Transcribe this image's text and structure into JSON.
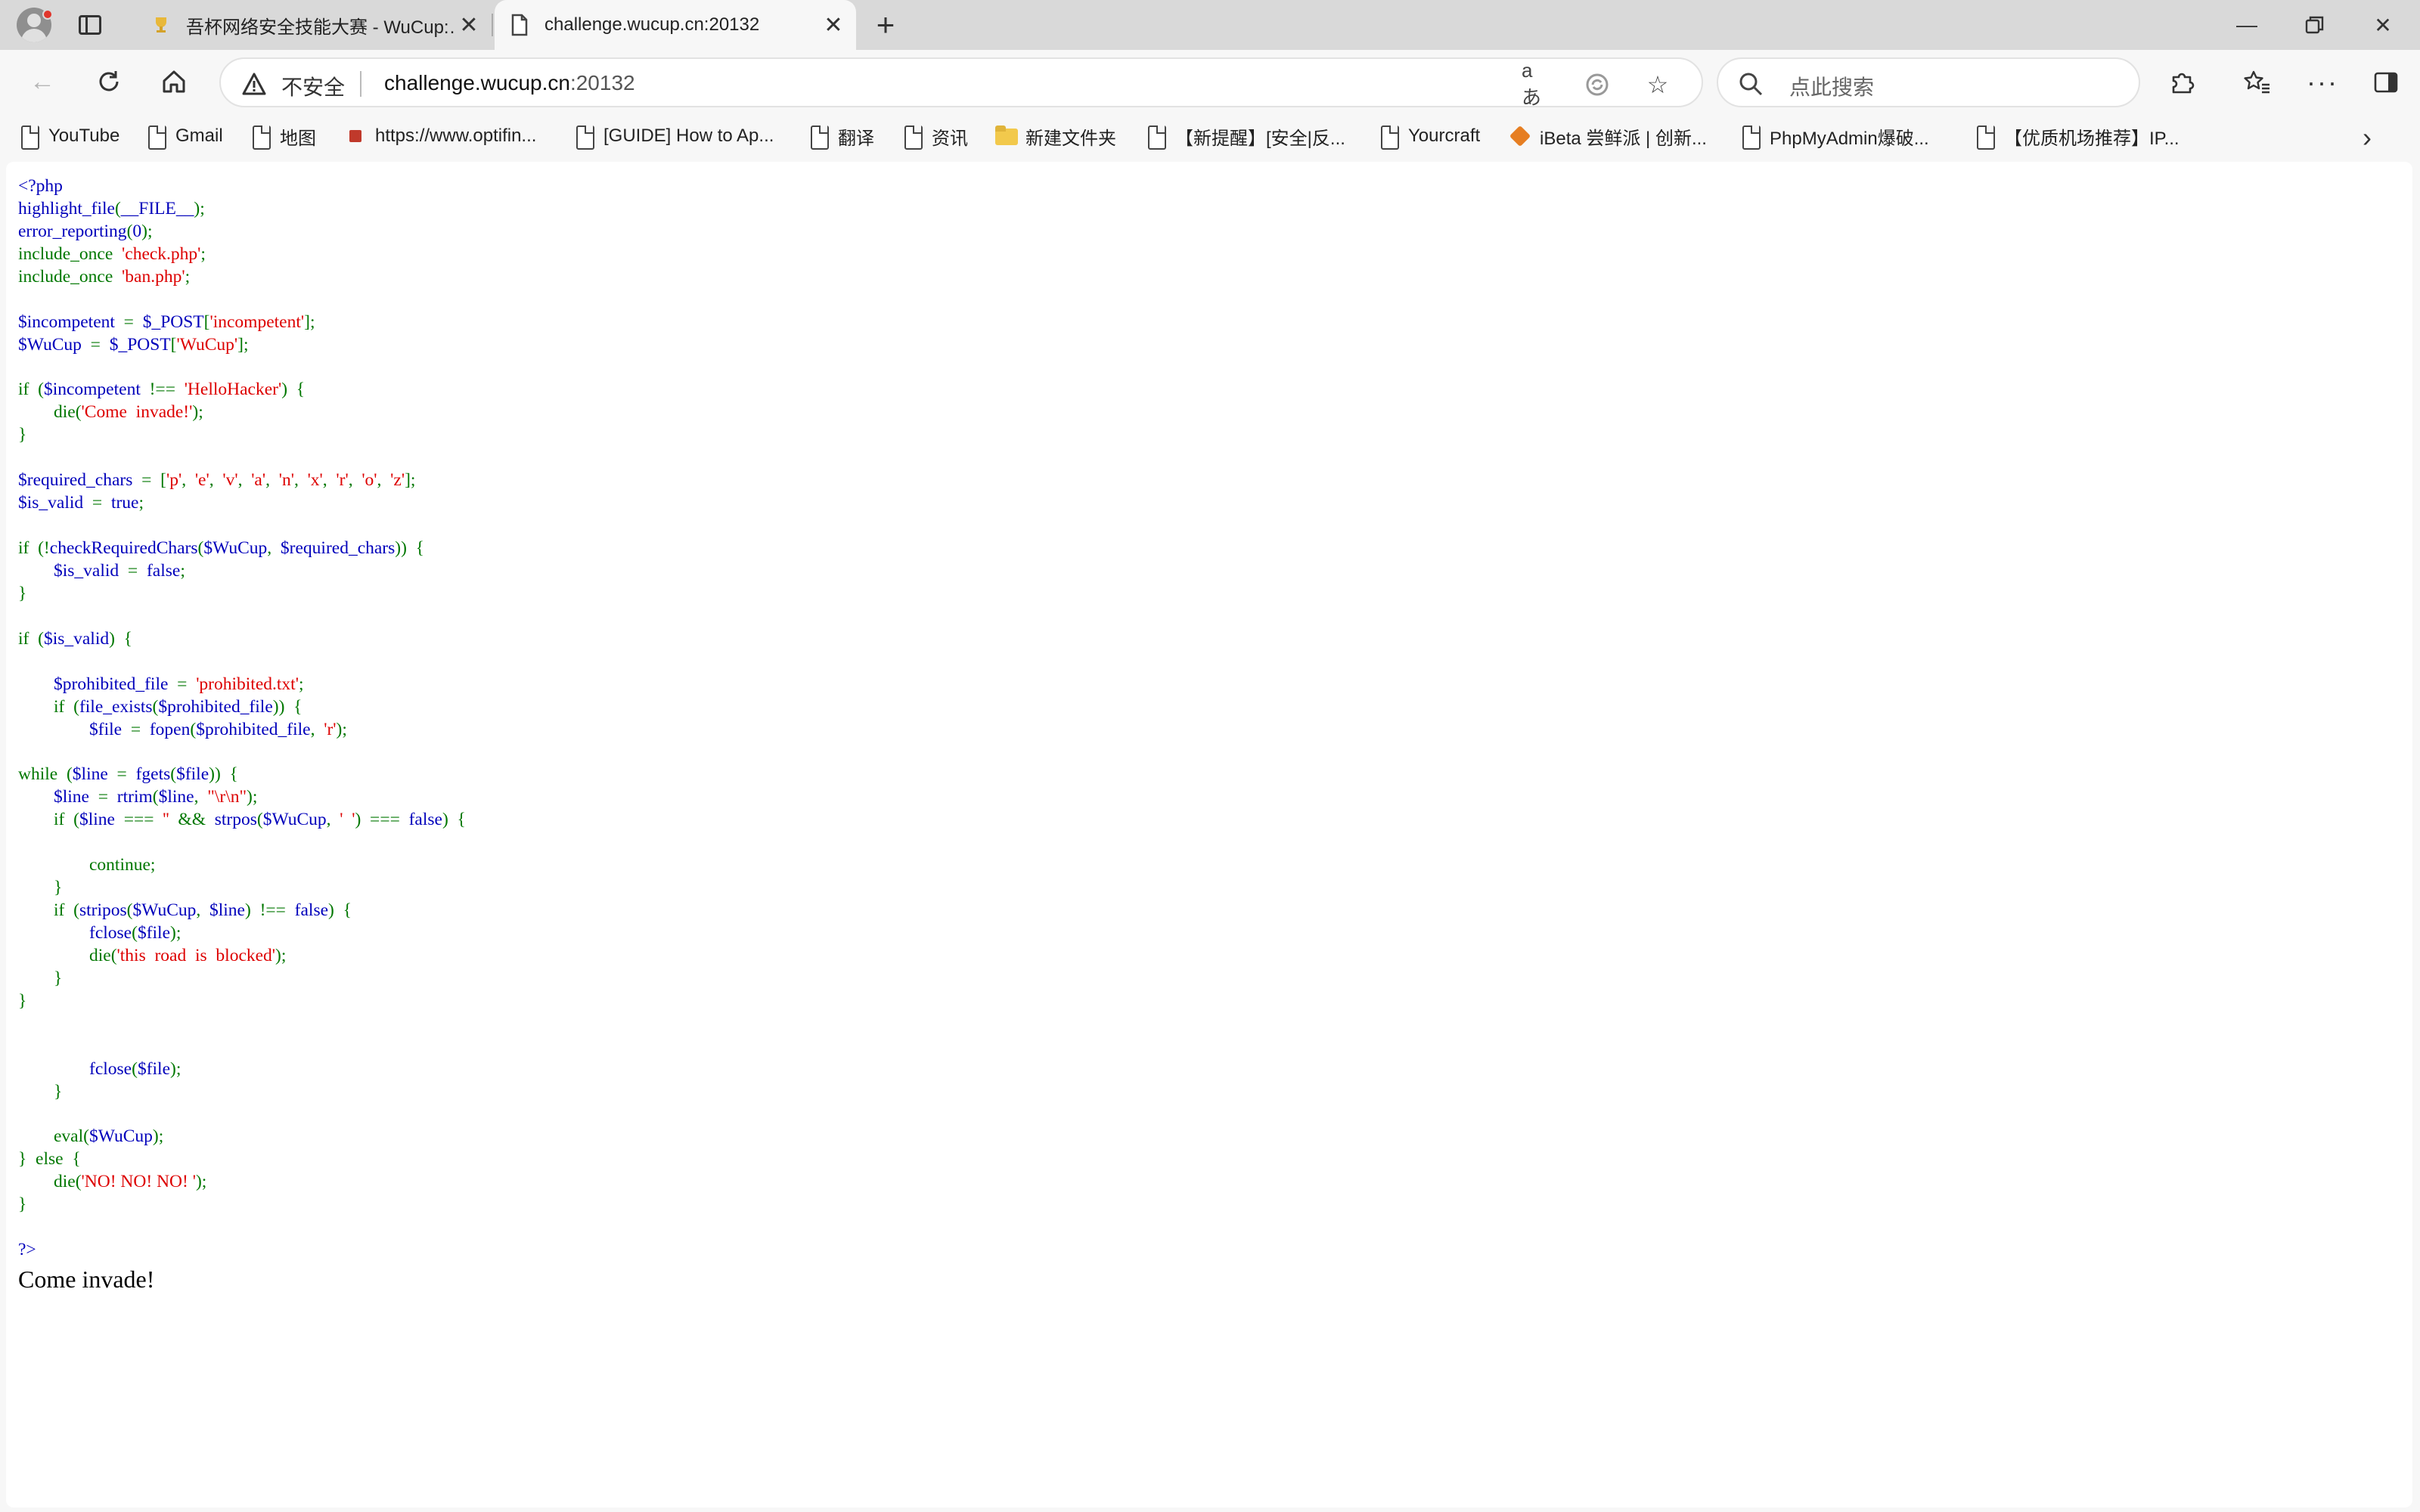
{
  "browser": {
    "tabs": [
      {
        "title": "吾杯网络安全技能大赛 - WuCup:…",
        "active": false
      },
      {
        "title": "challenge.wucup.cn:20132",
        "active": true
      }
    ],
    "address_bar": {
      "security_label": "不安全",
      "url_host": "challenge.wucup.cn",
      "url_port": ":20132"
    },
    "search": {
      "placeholder": "点此搜索"
    },
    "icons": {
      "back": "arrow-left-icon",
      "reload": "reload-icon",
      "home": "home-icon",
      "translate": "translate-icon",
      "star": "star-icon",
      "extensions": "puzzle-icon",
      "favorites": "favorites-icon",
      "more": "more-icon",
      "sidebar": "sidebar-icon"
    }
  },
  "bookmarks": [
    {
      "label": "YouTube",
      "icon": "doc"
    },
    {
      "label": "Gmail",
      "icon": "doc"
    },
    {
      "label": "地图",
      "icon": "doc"
    },
    {
      "label": "https://www.optifin...",
      "icon": "sq"
    },
    {
      "label": "[GUIDE] How to Ap...",
      "icon": "doc"
    },
    {
      "label": "翻译",
      "icon": "doc"
    },
    {
      "label": "资讯",
      "icon": "doc"
    },
    {
      "label": "新建文件夹",
      "icon": "folder"
    },
    {
      "label": "【新提醒】[安全|反...",
      "icon": "doc"
    },
    {
      "label": "Yourcraft",
      "icon": "doc"
    },
    {
      "label": "iBeta 尝鲜派 | 创新...",
      "icon": "ibeta"
    },
    {
      "label": "PhpMyAdmin爆破...",
      "icon": "doc"
    },
    {
      "label": "【优质机场推荐】IP...",
      "icon": "doc"
    }
  ],
  "code_lines": [
    [
      [
        "d",
        "&lt;?php"
      ]
    ],
    [
      [
        "d",
        "highlight_file"
      ],
      [
        "k",
        "("
      ],
      [
        "d",
        "__FILE__"
      ],
      [
        "k",
        ");"
      ]
    ],
    [
      [
        "d",
        "error_reporting"
      ],
      [
        "k",
        "("
      ],
      [
        "d",
        "0"
      ],
      [
        "k",
        ");"
      ]
    ],
    [
      [
        "k",
        "include_once&nbsp;&nbsp;"
      ],
      [
        "s",
        "'check.php'"
      ],
      [
        "k",
        ";"
      ]
    ],
    [
      [
        "k",
        "include_once&nbsp;&nbsp;"
      ],
      [
        "s",
        "'ban.php'"
      ],
      [
        "k",
        ";"
      ]
    ],
    [],
    [
      [
        "d",
        "$incompetent&nbsp;&nbsp;"
      ],
      [
        "k",
        "=&nbsp;&nbsp;"
      ],
      [
        "d",
        "$_POST"
      ],
      [
        "k",
        "["
      ],
      [
        "s",
        "'incompetent'"
      ],
      [
        "k",
        "];"
      ]
    ],
    [
      [
        "d",
        "$WuCup&nbsp;&nbsp;"
      ],
      [
        "k",
        "=&nbsp;&nbsp;"
      ],
      [
        "d",
        "$_POST"
      ],
      [
        "k",
        "["
      ],
      [
        "s",
        "'WuCup'"
      ],
      [
        "k",
        "];"
      ]
    ],
    [],
    [
      [
        "k",
        "if&nbsp;&nbsp;("
      ],
      [
        "d",
        "$incompetent&nbsp;&nbsp;"
      ],
      [
        "k",
        "!==&nbsp;&nbsp;"
      ],
      [
        "s",
        "'HelloHacker'"
      ],
      [
        "k",
        ")&nbsp;&nbsp;{"
      ]
    ],
    [
      [
        "k",
        "&nbsp;&nbsp;&nbsp;&nbsp;&nbsp;&nbsp;&nbsp;&nbsp;die("
      ],
      [
        "s",
        "'Come&nbsp;&nbsp;invade!'"
      ],
      [
        "k",
        ");"
      ]
    ],
    [
      [
        "k",
        "}"
      ]
    ],
    [],
    [
      [
        "d",
        "$required_chars&nbsp;&nbsp;"
      ],
      [
        "k",
        "=&nbsp;&nbsp;["
      ],
      [
        "s",
        "'p'"
      ],
      [
        "k",
        ",&nbsp;&nbsp;"
      ],
      [
        "s",
        "'e'"
      ],
      [
        "k",
        ",&nbsp;&nbsp;"
      ],
      [
        "s",
        "'v'"
      ],
      [
        "k",
        ",&nbsp;&nbsp;"
      ],
      [
        "s",
        "'a'"
      ],
      [
        "k",
        ",&nbsp;&nbsp;"
      ],
      [
        "s",
        "'n'"
      ],
      [
        "k",
        ",&nbsp;&nbsp;"
      ],
      [
        "s",
        "'x'"
      ],
      [
        "k",
        ",&nbsp;&nbsp;"
      ],
      [
        "s",
        "'r'"
      ],
      [
        "k",
        ",&nbsp;&nbsp;"
      ],
      [
        "s",
        "'o'"
      ],
      [
        "k",
        ",&nbsp;&nbsp;"
      ],
      [
        "s",
        "'z'"
      ],
      [
        "k",
        "];"
      ]
    ],
    [
      [
        "d",
        "$is_valid&nbsp;&nbsp;"
      ],
      [
        "k",
        "=&nbsp;&nbsp;"
      ],
      [
        "d",
        "true"
      ],
      [
        "k",
        ";"
      ]
    ],
    [],
    [
      [
        "k",
        "if&nbsp;&nbsp;(!"
      ],
      [
        "d",
        "checkRequiredChars"
      ],
      [
        "k",
        "("
      ],
      [
        "d",
        "$WuCup"
      ],
      [
        "k",
        ",&nbsp;&nbsp;"
      ],
      [
        "d",
        "$required_chars"
      ],
      [
        "k",
        "))&nbsp;&nbsp;{"
      ]
    ],
    [
      [
        "k",
        "&nbsp;&nbsp;&nbsp;&nbsp;&nbsp;&nbsp;&nbsp;&nbsp;"
      ],
      [
        "d",
        "$is_valid&nbsp;&nbsp;"
      ],
      [
        "k",
        "=&nbsp;&nbsp;"
      ],
      [
        "d",
        "false"
      ],
      [
        "k",
        ";"
      ]
    ],
    [
      [
        "k",
        "}"
      ]
    ],
    [],
    [
      [
        "k",
        "if&nbsp;&nbsp;("
      ],
      [
        "d",
        "$is_valid"
      ],
      [
        "k",
        ")&nbsp;&nbsp;{"
      ]
    ],
    [],
    [
      [
        "k",
        "&nbsp;&nbsp;&nbsp;&nbsp;&nbsp;&nbsp;&nbsp;&nbsp;"
      ],
      [
        "d",
        "$prohibited_file&nbsp;&nbsp;"
      ],
      [
        "k",
        "=&nbsp;&nbsp;"
      ],
      [
        "s",
        "'prohibited.txt'"
      ],
      [
        "k",
        ";"
      ]
    ],
    [
      [
        "k",
        "&nbsp;&nbsp;&nbsp;&nbsp;&nbsp;&nbsp;&nbsp;&nbsp;if&nbsp;&nbsp;("
      ],
      [
        "d",
        "file_exists"
      ],
      [
        "k",
        "("
      ],
      [
        "d",
        "$prohibited_file"
      ],
      [
        "k",
        "))&nbsp;&nbsp;{"
      ]
    ],
    [
      [
        "k",
        "&nbsp;&nbsp;&nbsp;&nbsp;&nbsp;&nbsp;&nbsp;&nbsp;&nbsp;&nbsp;&nbsp;&nbsp;&nbsp;&nbsp;&nbsp;&nbsp;"
      ],
      [
        "d",
        "$file&nbsp;&nbsp;"
      ],
      [
        "k",
        "=&nbsp;&nbsp;"
      ],
      [
        "d",
        "fopen"
      ],
      [
        "k",
        "("
      ],
      [
        "d",
        "$prohibited_file"
      ],
      [
        "k",
        ",&nbsp;&nbsp;"
      ],
      [
        "s",
        "'r'"
      ],
      [
        "k",
        ");"
      ]
    ],
    [],
    [
      [
        "k",
        "while&nbsp;&nbsp;("
      ],
      [
        "d",
        "$line&nbsp;&nbsp;"
      ],
      [
        "k",
        "=&nbsp;&nbsp;"
      ],
      [
        "d",
        "fgets"
      ],
      [
        "k",
        "("
      ],
      [
        "d",
        "$file"
      ],
      [
        "k",
        "))&nbsp;&nbsp;{"
      ]
    ],
    [
      [
        "k",
        "&nbsp;&nbsp;&nbsp;&nbsp;&nbsp;&nbsp;&nbsp;&nbsp;"
      ],
      [
        "d",
        "$line&nbsp;&nbsp;"
      ],
      [
        "k",
        "=&nbsp;&nbsp;"
      ],
      [
        "d",
        "rtrim"
      ],
      [
        "k",
        "("
      ],
      [
        "d",
        "$line"
      ],
      [
        "k",
        ",&nbsp;&nbsp;"
      ],
      [
        "s",
        "\"\\r\\n\""
      ],
      [
        "k",
        ");"
      ]
    ],
    [
      [
        "k",
        "&nbsp;&nbsp;&nbsp;&nbsp;&nbsp;&nbsp;&nbsp;&nbsp;if&nbsp;&nbsp;("
      ],
      [
        "d",
        "$line&nbsp;&nbsp;"
      ],
      [
        "k",
        "===&nbsp;&nbsp;"
      ],
      [
        "s",
        "''"
      ],
      [
        "k",
        "&nbsp;&nbsp;&amp;&amp;&nbsp;&nbsp;"
      ],
      [
        "d",
        "strpos"
      ],
      [
        "k",
        "("
      ],
      [
        "d",
        "$WuCup"
      ],
      [
        "k",
        ",&nbsp;&nbsp;"
      ],
      [
        "s",
        "'&nbsp;&nbsp;'"
      ],
      [
        "k",
        ")&nbsp;&nbsp;===&nbsp;&nbsp;"
      ],
      [
        "d",
        "false"
      ],
      [
        "k",
        ")&nbsp;&nbsp;{"
      ]
    ],
    [],
    [
      [
        "k",
        "&nbsp;&nbsp;&nbsp;&nbsp;&nbsp;&nbsp;&nbsp;&nbsp;&nbsp;&nbsp;&nbsp;&nbsp;&nbsp;&nbsp;&nbsp;&nbsp;continue;"
      ]
    ],
    [
      [
        "k",
        "&nbsp;&nbsp;&nbsp;&nbsp;&nbsp;&nbsp;&nbsp;&nbsp;}"
      ]
    ],
    [
      [
        "k",
        "&nbsp;&nbsp;&nbsp;&nbsp;&nbsp;&nbsp;&nbsp;&nbsp;if&nbsp;&nbsp;("
      ],
      [
        "d",
        "stripos"
      ],
      [
        "k",
        "("
      ],
      [
        "d",
        "$WuCup"
      ],
      [
        "k",
        ",&nbsp;&nbsp;"
      ],
      [
        "d",
        "$line"
      ],
      [
        "k",
        ")&nbsp;&nbsp;!==&nbsp;&nbsp;"
      ],
      [
        "d",
        "false"
      ],
      [
        "k",
        ")&nbsp;&nbsp;{"
      ]
    ],
    [
      [
        "k",
        "&nbsp;&nbsp;&nbsp;&nbsp;&nbsp;&nbsp;&nbsp;&nbsp;&nbsp;&nbsp;&nbsp;&nbsp;&nbsp;&nbsp;&nbsp;&nbsp;"
      ],
      [
        "d",
        "fclose"
      ],
      [
        "k",
        "("
      ],
      [
        "d",
        "$file"
      ],
      [
        "k",
        ");"
      ]
    ],
    [
      [
        "k",
        "&nbsp;&nbsp;&nbsp;&nbsp;&nbsp;&nbsp;&nbsp;&nbsp;&nbsp;&nbsp;&nbsp;&nbsp;&nbsp;&nbsp;&nbsp;&nbsp;die("
      ],
      [
        "s",
        "'this&nbsp;&nbsp;road&nbsp;&nbsp;is&nbsp;&nbsp;blocked'"
      ],
      [
        "k",
        ");"
      ]
    ],
    [
      [
        "k",
        "&nbsp;&nbsp;&nbsp;&nbsp;&nbsp;&nbsp;&nbsp;&nbsp;}"
      ]
    ],
    [
      [
        "k",
        "}"
      ]
    ],
    [],
    [],
    [
      [
        "k",
        "&nbsp;&nbsp;&nbsp;&nbsp;&nbsp;&nbsp;&nbsp;&nbsp;&nbsp;&nbsp;&nbsp;&nbsp;&nbsp;&nbsp;&nbsp;&nbsp;"
      ],
      [
        "d",
        "fclose"
      ],
      [
        "k",
        "("
      ],
      [
        "d",
        "$file"
      ],
      [
        "k",
        ");"
      ]
    ],
    [
      [
        "k",
        "&nbsp;&nbsp;&nbsp;&nbsp;&nbsp;&nbsp;&nbsp;&nbsp;}"
      ]
    ],
    [],
    [
      [
        "k",
        "&nbsp;&nbsp;&nbsp;&nbsp;&nbsp;&nbsp;&nbsp;&nbsp;eval("
      ],
      [
        "d",
        "$WuCup"
      ],
      [
        "k",
        ");"
      ]
    ],
    [
      [
        "k",
        "}&nbsp;&nbsp;else&nbsp;&nbsp;{"
      ]
    ],
    [
      [
        "k",
        "&nbsp;&nbsp;&nbsp;&nbsp;&nbsp;&nbsp;&nbsp;&nbsp;die("
      ],
      [
        "s",
        "'NO!&nbsp;NO!&nbsp;NO!&nbsp;'"
      ],
      [
        "k",
        ");"
      ]
    ],
    [
      [
        "k",
        "}"
      ]
    ],
    [],
    [
      [
        "d",
        "?&gt;"
      ]
    ]
  ],
  "output_text": "Come invade!",
  "colors": {
    "php_default": "#0000BB",
    "php_keyword": "#007700",
    "php_string": "#DD0000"
  }
}
